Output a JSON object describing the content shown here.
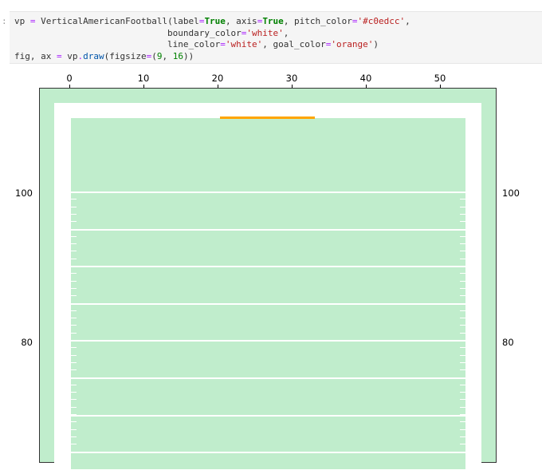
{
  "cell": {
    "prompt": ":",
    "code_lines": [
      [
        [
          "vp ",
          ""
        ],
        [
          "=",
          "op"
        ],
        [
          " VerticalAmericanFootball(label",
          ""
        ],
        [
          "=",
          "op"
        ],
        [
          "True",
          "kw"
        ],
        [
          ", axis",
          ""
        ],
        [
          "=",
          "op"
        ],
        [
          "True",
          "kw"
        ],
        [
          ", pitch_color",
          ""
        ],
        [
          "=",
          "op"
        ],
        [
          "'#c0edcc'",
          "str"
        ],
        [
          ",",
          ""
        ]
      ],
      [
        [
          "                             boundary_color",
          ""
        ],
        [
          "=",
          "op"
        ],
        [
          "'white'",
          "str"
        ],
        [
          ",",
          ""
        ]
      ],
      [
        [
          "                             line_color",
          ""
        ],
        [
          "=",
          "op"
        ],
        [
          "'white'",
          "str"
        ],
        [
          ", goal_color",
          ""
        ],
        [
          "=",
          "op"
        ],
        [
          "'orange'",
          "str"
        ],
        [
          ")",
          ""
        ]
      ],
      [
        [
          "fig, ax ",
          ""
        ],
        [
          "=",
          "op"
        ],
        [
          " vp",
          ""
        ],
        [
          ".",
          "op"
        ],
        [
          "draw",
          "fn"
        ],
        [
          "(figsize",
          ""
        ],
        [
          "=",
          "op"
        ],
        [
          "(",
          ""
        ],
        [
          "9",
          "num"
        ],
        [
          ", ",
          ""
        ],
        [
          "16",
          "num"
        ],
        [
          "))",
          ""
        ]
      ]
    ]
  },
  "plot": {
    "x_ticks": [
      "0",
      "10",
      "20",
      "30",
      "40",
      "50"
    ],
    "y_ticks_left": [
      "100",
      "80"
    ],
    "y_ticks_right": [
      "100",
      "80"
    ],
    "colors": {
      "pitch": "#c0edcc",
      "boundary": "#ffffff",
      "line": "#ffffff",
      "goal": "orange"
    },
    "yard_lines_visible": 8
  }
}
